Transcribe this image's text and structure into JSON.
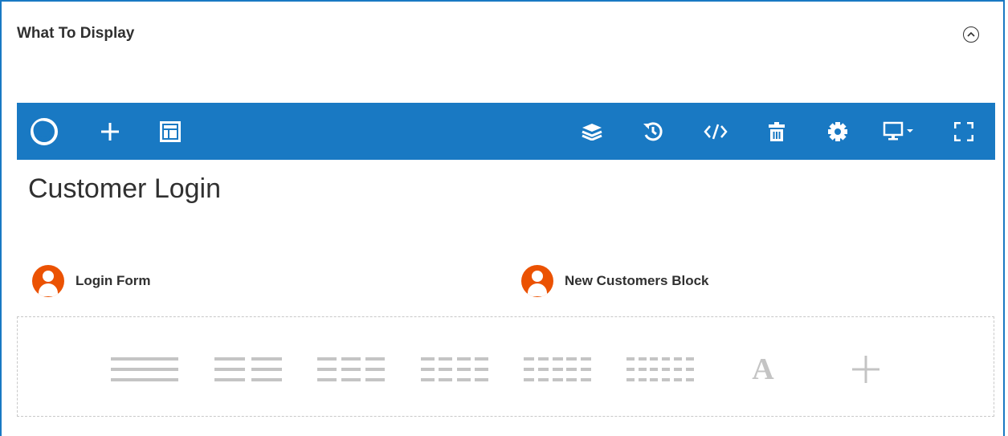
{
  "section": {
    "title": "What To Display"
  },
  "toolbar": {
    "color": "#1979c3",
    "left_icons": [
      "pagebuilder-logo-icon",
      "add-icon",
      "template-icon"
    ],
    "right_icons": [
      "layers-icon",
      "history-icon",
      "code-icon",
      "trash-icon",
      "settings-icon",
      "monitor-dropdown-icon",
      "fullscreen-icon"
    ]
  },
  "content": {
    "page_title": "Customer Login",
    "blocks": [
      {
        "label": "Login Form",
        "icon": "user-icon"
      },
      {
        "label": "New Customers Block",
        "icon": "user-icon"
      }
    ],
    "layout_options": [
      "1-column",
      "2-column",
      "3-column",
      "4-column",
      "5-column",
      "6-column",
      "text-block",
      "add"
    ],
    "layout_option_text": "A"
  },
  "colors": {
    "accent": "#1979c3",
    "avatar": "#eb5202",
    "muted": "#c4c4c4"
  }
}
